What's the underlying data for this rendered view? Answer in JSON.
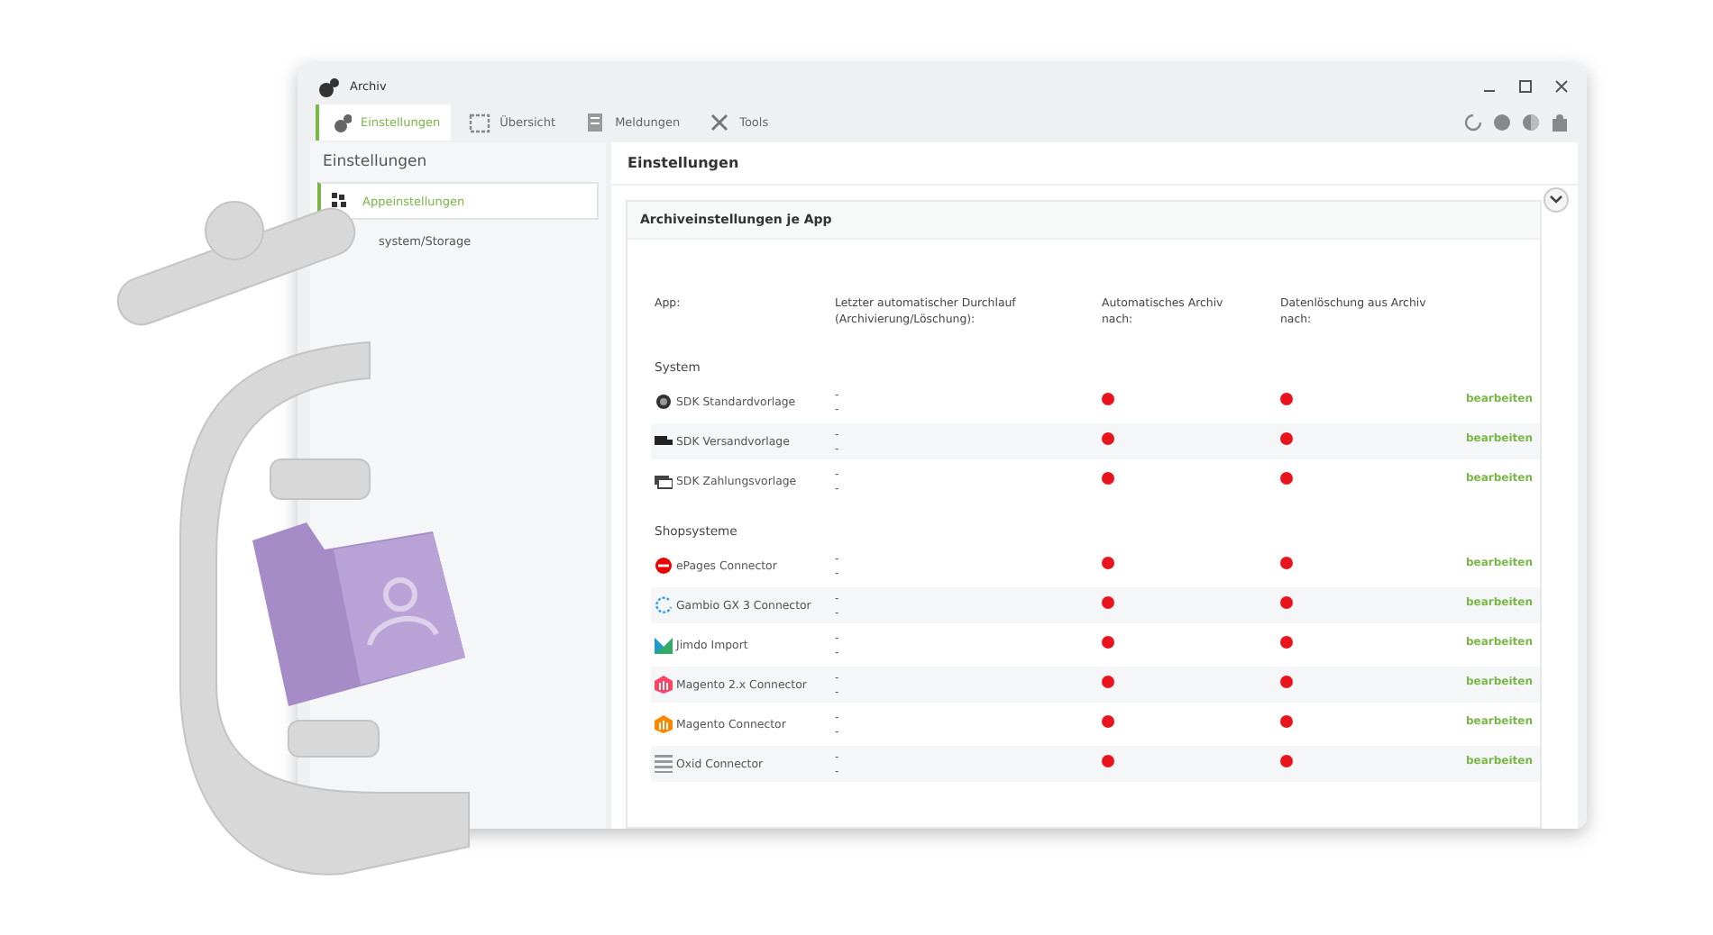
{
  "window": {
    "title": "Archiv"
  },
  "tabs": [
    {
      "label": "Einstellungen",
      "selected": true
    },
    {
      "label": "Übersicht",
      "selected": false
    },
    {
      "label": "Meldungen",
      "selected": false
    },
    {
      "label": "Tools",
      "selected": false
    }
  ],
  "sidebar": {
    "title": "Einstellungen",
    "items": [
      {
        "label": "Appeinstellungen",
        "selected": true
      },
      {
        "label": "system/Storage",
        "selected": false
      }
    ]
  },
  "content": {
    "title": "Einstellungen",
    "panel": {
      "title": "Archiveinstellungen je App",
      "expanded": true,
      "columns": [
        "App:",
        "Letzter automatischer Durchlauf\n(Archivierung/Löschung):",
        "Automatisches Archiv\nnach:",
        "Datenlöschung aus Archiv\nnach:"
      ],
      "groups": [
        {
          "name": "System",
          "rows": [
            {
              "app": "SDK Standardvorlage",
              "last_run": "-\n-",
              "auto_archive": false,
              "deletion": false,
              "action": "bearbeiten"
            },
            {
              "app": "SDK Versandvorlage",
              "last_run": "-\n-",
              "auto_archive": false,
              "deletion": false,
              "action": "bearbeiten"
            },
            {
              "app": "SDK Zahlungsvorlage",
              "last_run": "-\n-",
              "auto_archive": false,
              "deletion": false,
              "action": "bearbeiten"
            }
          ]
        },
        {
          "name": "Shopsysteme",
          "rows": [
            {
              "app": "ePages Connector",
              "last_run": "-\n-",
              "auto_archive": false,
              "deletion": false,
              "action": "bearbeiten"
            },
            {
              "app": "Gambio GX 3 Connector",
              "last_run": "-\n-",
              "auto_archive": false,
              "deletion": false,
              "action": "bearbeiten"
            },
            {
              "app": "Jimdo Import",
              "last_run": "-\n-",
              "auto_archive": false,
              "deletion": false,
              "action": "bearbeiten"
            },
            {
              "app": "Magento 2.x Connector",
              "last_run": "-\n-",
              "auto_archive": false,
              "deletion": false,
              "action": "bearbeiten"
            },
            {
              "app": "Magento Connector",
              "last_run": "-\n-",
              "auto_archive": false,
              "deletion": false,
              "action": "bearbeiten"
            },
            {
              "app": "Oxid Connector",
              "last_run": "-\n-",
              "auto_archive": false,
              "deletion": false,
              "action": "bearbeiten"
            }
          ]
        }
      ]
    }
  }
}
